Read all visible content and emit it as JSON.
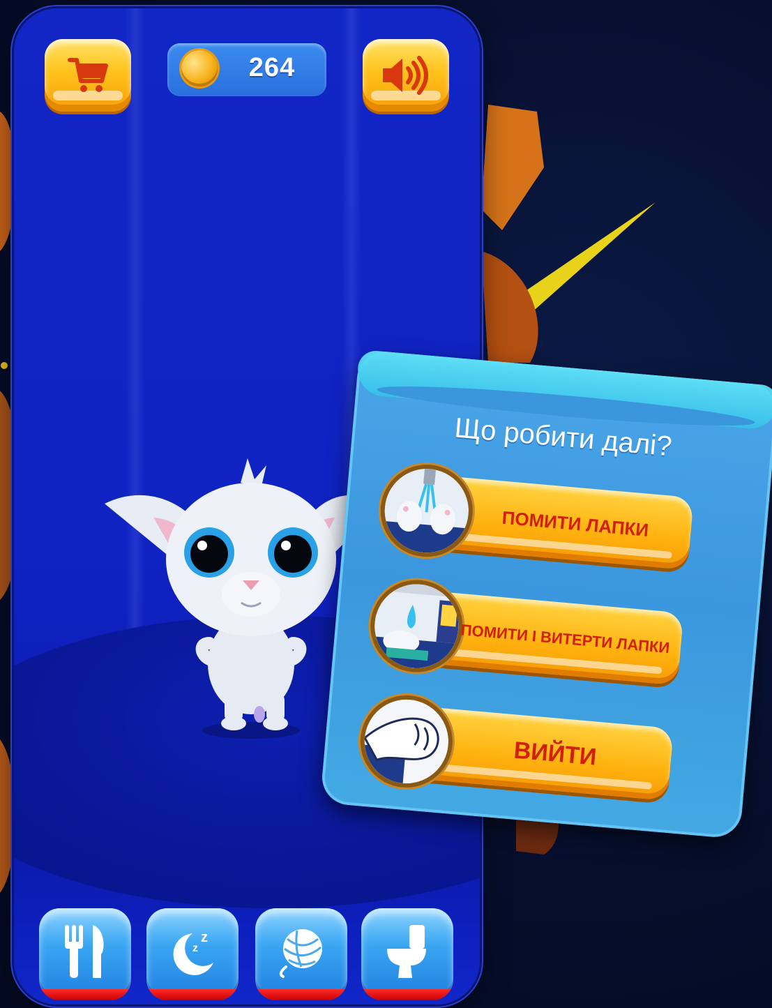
{
  "hud": {
    "coins": "264",
    "shop_icon": "shopping-cart-icon",
    "sound_icon": "speaker-sound-icon"
  },
  "dialog": {
    "title": "Що робити далі?",
    "options": [
      {
        "label": "ПОМИТИ ЛАПКИ",
        "icon": "wash-paws-icon"
      },
      {
        "label": "ПОМИТИ І ВИТЕРТИ ЛАПКИ",
        "icon": "wash-dry-paws-icon"
      },
      {
        "label": "ВИЙТИ",
        "icon": "exit-paw-icon"
      }
    ]
  },
  "actions": [
    {
      "name": "feed",
      "icon": "fork-knife-icon"
    },
    {
      "name": "sleep",
      "icon": "moon-sleep-icon"
    },
    {
      "name": "play",
      "icon": "yarn-ball-icon"
    },
    {
      "name": "toilet",
      "icon": "toilet-icon"
    }
  ],
  "colors": {
    "phone_bg": "#1126c4",
    "button_gold": "#ffc21b",
    "button_label": "#d2210b",
    "dialog_bg": "#3b97dd",
    "action_bar_red": "#e00000"
  }
}
